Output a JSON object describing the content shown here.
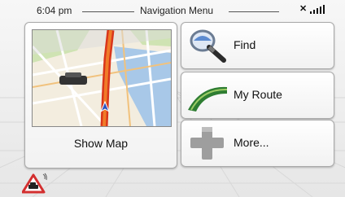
{
  "header": {
    "time": "6:04 pm",
    "title": "Navigation Menu",
    "status_icons": [
      "satellite-icon",
      "signal-strength-icon"
    ]
  },
  "menu": {
    "map_tile": {
      "label": "Show Map",
      "icon": "map-preview"
    },
    "find": {
      "label": "Find",
      "icon": "magnifier-icon"
    },
    "route": {
      "label": "My Route",
      "icon": "route-icon"
    },
    "more": {
      "label": "More...",
      "icon": "plus-icon"
    }
  },
  "footer": {
    "alert_icon": "traffic-warning-icon"
  },
  "colors": {
    "background": "#eeeeee",
    "route_green": "#2e7d32",
    "plus_gray": "#9e9e9e",
    "warning_red": "#d32f2f"
  }
}
